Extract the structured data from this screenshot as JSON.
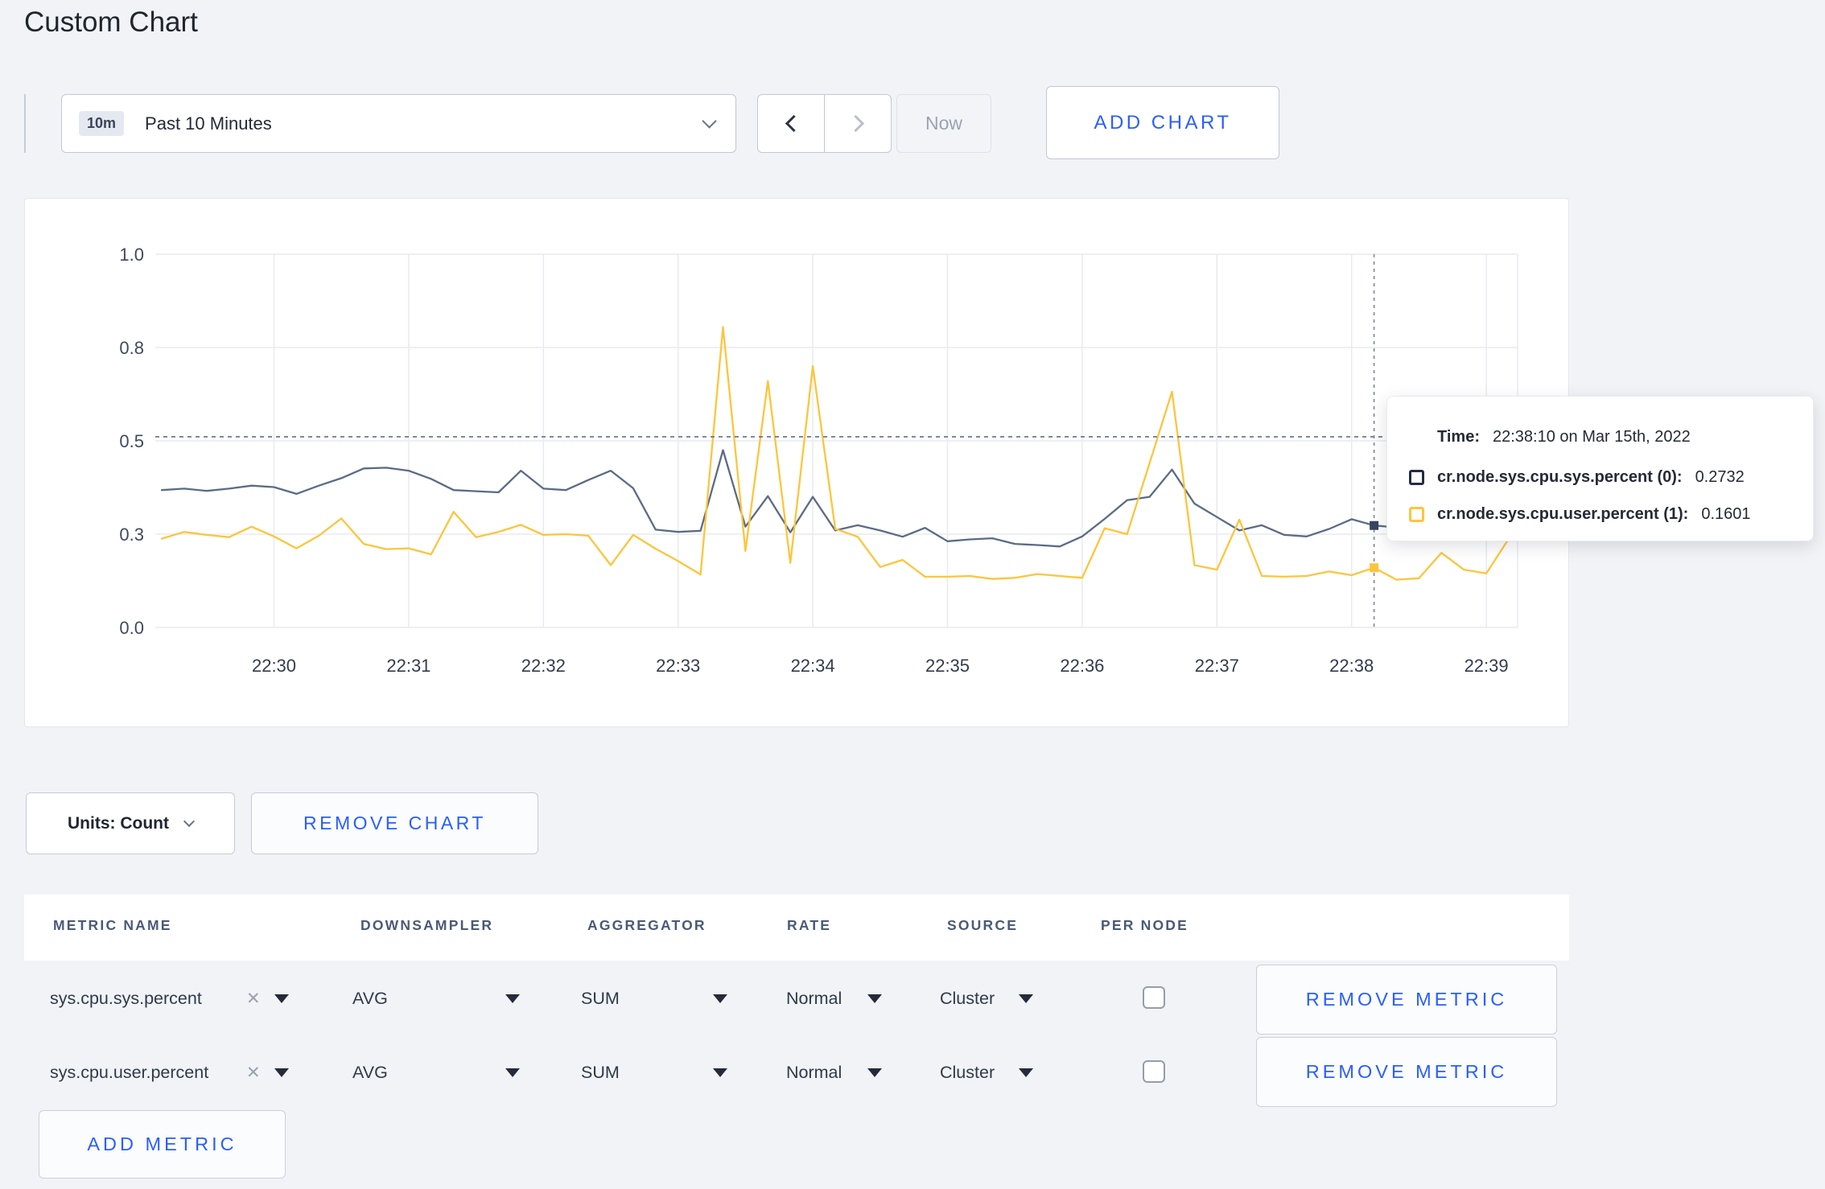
{
  "page": {
    "title": "Custom Chart"
  },
  "controls": {
    "time_badge": "10m",
    "time_label": "Past 10 Minutes",
    "now_label": "Now",
    "add_chart_label": "ADD CHART"
  },
  "chart_data": {
    "type": "line",
    "title": "",
    "xlabel": "",
    "ylabel": "",
    "ylim": [
      0,
      1
    ],
    "grid": true,
    "legend": false,
    "x_tick_labels": [
      "22:30",
      "22:31",
      "22:32",
      "22:33",
      "22:34",
      "22:35",
      "22:36",
      "22:37",
      "22:38",
      "22:39"
    ],
    "y_tick_labels": [
      "0.0",
      "0.3",
      "0.5",
      "0.8",
      "1.0"
    ],
    "y_tick_values": [
      0,
      0.25,
      0.5,
      0.75,
      1.0
    ],
    "x_start": "22:29:10",
    "x_interval_seconds": 10,
    "series": [
      {
        "name": "cr.node.sys.cpu.sys.percent",
        "color": "#5b6b85",
        "values": [
          0.368,
          0.372,
          0.366,
          0.372,
          0.38,
          0.376,
          0.358,
          0.38,
          0.4,
          0.426,
          0.428,
          0.42,
          0.398,
          0.368,
          0.365,
          0.362,
          0.42,
          0.372,
          0.368,
          0.395,
          0.42,
          0.373,
          0.262,
          0.256,
          0.259,
          0.475,
          0.27,
          0.352,
          0.255,
          0.35,
          0.26,
          0.274,
          0.26,
          0.243,
          0.267,
          0.231,
          0.236,
          0.239,
          0.224,
          0.221,
          0.217,
          0.244,
          0.291,
          0.341,
          0.35,
          0.423,
          0.332,
          0.296,
          0.26,
          0.274,
          0.248,
          0.244,
          0.264,
          0.29,
          0.2732,
          0.268,
          0.263,
          0.268,
          0.278,
          0.263,
          0.274
        ]
      },
      {
        "name": "cr.node.sys.cpu.user.percent",
        "color": "#fdc53c",
        "values": [
          0.238,
          0.256,
          0.248,
          0.242,
          0.27,
          0.244,
          0.212,
          0.246,
          0.292,
          0.224,
          0.21,
          0.212,
          0.196,
          0.31,
          0.242,
          0.256,
          0.275,
          0.248,
          0.25,
          0.246,
          0.167,
          0.248,
          0.211,
          0.178,
          0.142,
          0.805,
          0.205,
          0.66,
          0.173,
          0.7,
          0.264,
          0.243,
          0.162,
          0.181,
          0.136,
          0.136,
          0.138,
          0.13,
          0.133,
          0.143,
          0.138,
          0.133,
          0.266,
          0.25,
          0.44,
          0.632,
          0.167,
          0.155,
          0.289,
          0.138,
          0.136,
          0.138,
          0.15,
          0.14,
          0.1601,
          0.128,
          0.132,
          0.2,
          0.155,
          0.145,
          0.238
        ]
      }
    ],
    "crosshair": {
      "time": "22:38:10",
      "hline_value": 0.511,
      "marker_values": [
        0.2732,
        0.1601
      ]
    }
  },
  "tooltip": {
    "time_label": "Time:",
    "time_value": "22:38:10 on Mar 15th, 2022",
    "rows": [
      {
        "name": "cr.node.sys.cpu.sys.percent (0):",
        "value": "0.2732",
        "color": "#232c41"
      },
      {
        "name": "cr.node.sys.cpu.user.percent (1):",
        "value": "0.1601",
        "color": "#ffc53d"
      }
    ]
  },
  "chart_footer": {
    "units_label": "Units: Count",
    "remove_chart_label": "REMOVE CHART"
  },
  "metrics_table": {
    "headers": [
      "METRIC NAME",
      "DOWNSAMPLER",
      "AGGREGATOR",
      "RATE",
      "SOURCE",
      "PER NODE"
    ],
    "rows": [
      {
        "metric": "sys.cpu.sys.percent",
        "downsampler": "AVG",
        "aggregator": "SUM",
        "rate": "Normal",
        "source": "Cluster",
        "per_node_checked": false,
        "remove_label": "REMOVE METRIC"
      },
      {
        "metric": "sys.cpu.user.percent",
        "downsampler": "AVG",
        "aggregator": "SUM",
        "rate": "Normal",
        "source": "Cluster",
        "per_node_checked": false,
        "remove_label": "REMOVE METRIC"
      }
    ],
    "add_metric_label": "ADD METRIC"
  }
}
